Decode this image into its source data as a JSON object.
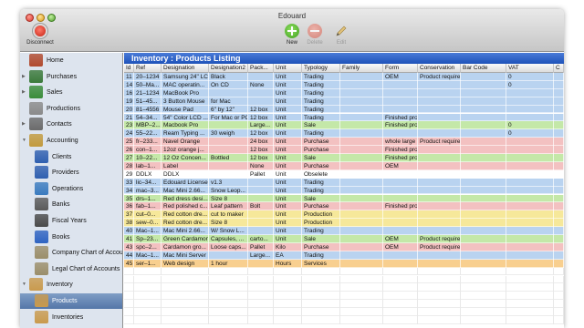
{
  "window": {
    "title": "Edouard"
  },
  "toolbar": {
    "disconnect_label": "Disconnect",
    "new_label": "New",
    "delete_label": "Delete",
    "edit_label": "Edit"
  },
  "sidebar": {
    "items": [
      {
        "label": "Home",
        "icon": "house-icon",
        "level": 0,
        "disc": "",
        "color": "#b14a2f"
      },
      {
        "label": "Purchases",
        "icon": "cart-icon",
        "level": 0,
        "disc": "▶",
        "color": "#3b7a3b"
      },
      {
        "label": "Sales",
        "icon": "cash-register-icon",
        "level": 0,
        "disc": "▶",
        "color": "#3a8c3a"
      },
      {
        "label": "Productions",
        "icon": "gears-icon",
        "level": 0,
        "disc": "",
        "color": "#8a8a8a"
      },
      {
        "label": "Contacts",
        "icon": "address-book-icon",
        "level": 0,
        "disc": "▶",
        "color": "#6b6b6b"
      },
      {
        "label": "Accounting",
        "icon": "coins-icon",
        "level": 0,
        "disc": "▼",
        "color": "#c29a3d"
      },
      {
        "label": "Clients",
        "icon": "person-icon",
        "level": 1,
        "disc": "",
        "color": "#2f5fb0"
      },
      {
        "label": "Providers",
        "icon": "person-icon",
        "level": 1,
        "disc": "",
        "color": "#2f5fb0"
      },
      {
        "label": "Operations",
        "icon": "globe-icon",
        "level": 1,
        "disc": "",
        "color": "#3a7bbf"
      },
      {
        "label": "Banks",
        "icon": "bank-icon",
        "level": 1,
        "disc": "",
        "color": "#5a5a5a"
      },
      {
        "label": "Fiscal Years",
        "icon": "calendar-icon",
        "level": 1,
        "disc": "",
        "color": "#4a4a4a"
      },
      {
        "label": "Books",
        "icon": "book-icon",
        "level": 1,
        "disc": "",
        "color": "#2e63c2"
      },
      {
        "label": "Company Chart of Accounts",
        "icon": "chart-sheet-icon",
        "level": 1,
        "disc": "",
        "color": "#9b8e6a"
      },
      {
        "label": "Legal Chart of Accounts",
        "icon": "chart-sheet-icon",
        "level": 1,
        "disc": "",
        "color": "#9b8e6a"
      },
      {
        "label": "Inventory",
        "icon": "box-icon",
        "level": 0,
        "disc": "▼",
        "color": "#c99a4d"
      },
      {
        "label": "Products",
        "icon": "box-icon",
        "level": 1,
        "disc": "",
        "color": "#c99a4d",
        "selected": true
      },
      {
        "label": "Inventories",
        "icon": "box-icon",
        "level": 1,
        "disc": "",
        "color": "#c99a4d"
      }
    ]
  },
  "listing": {
    "title": "Inventory : Products Listing",
    "columns": [
      "Id",
      "Ref",
      "Designation",
      "Designation2",
      "Pack...",
      "Unit",
      "Typology",
      "Family",
      "Form",
      "Conservation",
      "Bar Code",
      "VAT",
      "C"
    ],
    "rows": [
      {
        "cells": [
          "11",
          "20–1234",
          "Samsung 24\" LCD",
          "Black",
          "",
          "Unit",
          "Trading",
          "",
          "OEM",
          "Product require",
          "",
          "0",
          ""
        ],
        "color": "#b9d3f0"
      },
      {
        "cells": [
          "14",
          "50–Ma...",
          "MAC operatin...",
          "On CD",
          "None",
          "Unit",
          "Trading",
          "",
          "",
          "",
          "",
          "0",
          ""
        ],
        "color": "#b9d3f0"
      },
      {
        "cells": [
          "16",
          "21–1234",
          "MacBook Pro",
          "",
          "",
          "Unit",
          "Trading",
          "",
          "",
          "",
          "",
          "",
          ""
        ],
        "color": "#b9d3f0"
      },
      {
        "cells": [
          "19",
          "51–45...",
          "3 Button Mouse",
          "for Mac",
          "",
          "Unit",
          "Trading",
          "",
          "",
          "",
          "",
          "",
          ""
        ],
        "color": "#b9d3f0"
      },
      {
        "cells": [
          "20",
          "81–4556",
          "Mouse Pad",
          "6\" by 12\"",
          "12 box",
          "Unit",
          "Trading",
          "",
          "",
          "",
          "",
          "",
          ""
        ],
        "color": "#b9d3f0"
      },
      {
        "cells": [
          "21",
          "54–34...",
          "54\" Color LCD ...",
          "For Mac or PC",
          "12 box",
          "Unit",
          "Trading",
          "",
          "Finished pro",
          "",
          "",
          "",
          ""
        ],
        "color": "#b9d3f0"
      },
      {
        "cells": [
          "23",
          "MBP–2...",
          "Macbook Pro",
          "",
          "Large...",
          "Unit",
          "Sale",
          "",
          "Finished pro",
          "",
          "",
          "0",
          ""
        ],
        "color": "#c4e8a8"
      },
      {
        "cells": [
          "24",
          "55–22...",
          "Ream Typing ...",
          "30 weigh",
          "12 box",
          "Unit",
          "Trading",
          "",
          "",
          "",
          "",
          "0",
          ""
        ],
        "color": "#b9d3f0"
      },
      {
        "cells": [
          "25",
          "fr–233...",
          "Navel Orange",
          "",
          "24 box",
          "Unit",
          "Purchase",
          "",
          "whole large",
          "Product require",
          "",
          "",
          ""
        ],
        "color": "#f3c1c1"
      },
      {
        "cells": [
          "26",
          "con–1...",
          "12oz orange j...",
          "",
          "12 box",
          "Unit",
          "Purchase",
          "",
          "Finished pro",
          "",
          "",
          "",
          ""
        ],
        "color": "#f3c1c1"
      },
      {
        "cells": [
          "27",
          "10–22...",
          "12 Oz Concen...",
          "Bottled",
          "12 box",
          "Unit",
          "Sale",
          "",
          "Finished pro",
          "",
          "",
          "",
          ""
        ],
        "color": "#c4e8a8"
      },
      {
        "cells": [
          "28",
          "lab–1...",
          "Label",
          "",
          "None",
          "Unit",
          "Purchase",
          "",
          "OEM",
          "",
          "",
          "",
          ""
        ],
        "color": "#f3c1c1"
      },
      {
        "cells": [
          "29",
          "DDLX",
          "DDLX",
          "",
          "Pallet",
          "Unit",
          "Obselete",
          "",
          "",
          "",
          "",
          "",
          ""
        ],
        "color": "#ffffff"
      },
      {
        "cells": [
          "33",
          "lic–34...",
          "Edouard License",
          "v1.3",
          "",
          "Unit",
          "Trading",
          "",
          "",
          "",
          "",
          "",
          ""
        ],
        "color": "#b9d3f0"
      },
      {
        "cells": [
          "34",
          "mac–3...",
          "Mac Mini 2.66...",
          "Snow Leop...",
          "",
          "Unit",
          "Trading",
          "",
          "",
          "",
          "",
          "",
          ""
        ],
        "color": "#b9d3f0"
      },
      {
        "cells": [
          "35",
          "drs–1...",
          "Red dress desi...",
          "Size 8",
          "",
          "Unit",
          "Sale",
          "",
          "",
          "",
          "",
          "",
          ""
        ],
        "color": "#c4e8a8"
      },
      {
        "cells": [
          "36",
          "fab–1...",
          "Red polished c...",
          "Leaf pattern",
          "Bolt",
          "Unit",
          "Purchase",
          "",
          "Finished pro",
          "",
          "",
          "",
          ""
        ],
        "color": "#f3c1c1"
      },
      {
        "cells": [
          "37",
          "cut–0...",
          "Red cotton dre...",
          "cut to maker",
          "",
          "Unit",
          "Production",
          "",
          "",
          "",
          "",
          "",
          ""
        ],
        "color": "#f6e89a"
      },
      {
        "cells": [
          "38",
          "sew–0...",
          "Red cotton dre...",
          "Size 8",
          "",
          "Unit",
          "Production",
          "",
          "",
          "",
          "",
          "",
          ""
        ],
        "color": "#f6e89a"
      },
      {
        "cells": [
          "40",
          "Mac–1...",
          "Mac Mini 2.66...",
          "W/ Snow L...",
          "",
          "Unit",
          "Trading",
          "",
          "",
          "",
          "",
          "",
          ""
        ],
        "color": "#b9d3f0"
      },
      {
        "cells": [
          "41",
          "Sp–23...",
          "Green Cardamon",
          "Capsules, ...",
          "carto...",
          "Unit",
          "Sale",
          "",
          "OEM",
          "Product require",
          "",
          "",
          ""
        ],
        "color": "#c4e8a8"
      },
      {
        "cells": [
          "43",
          "spc–2...",
          "Cardamon gro...",
          "Loose caps...",
          "Pallet",
          "Kilo",
          "Purchase",
          "",
          "OEM",
          "Product require",
          "",
          "",
          ""
        ],
        "color": "#f3c1c1"
      },
      {
        "cells": [
          "44",
          "Mac–1...",
          "Mac Mini Server",
          "",
          "Large...",
          "EA",
          "Trading",
          "",
          "",
          "",
          "",
          "",
          ""
        ],
        "color": "#b9d3f0"
      },
      {
        "cells": [
          "45",
          "ser–1...",
          "Web design",
          "1 hour",
          "",
          "Hours",
          "Services",
          "",
          "",
          "",
          "",
          "",
          ""
        ],
        "color": "#f8cf8f"
      }
    ],
    "empty_rows": 7
  }
}
